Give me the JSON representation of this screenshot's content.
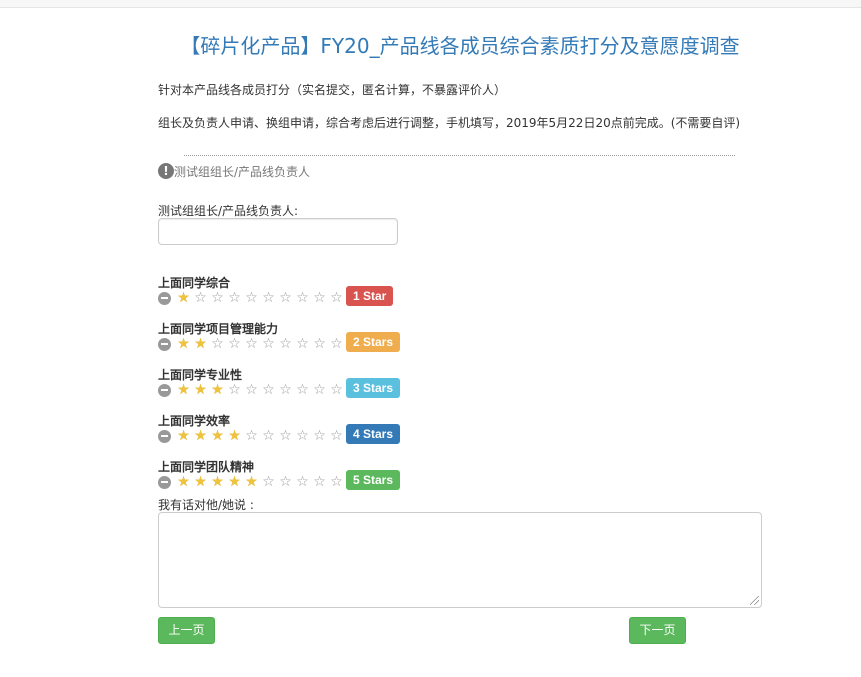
{
  "page": {
    "title": "【碎片化产品】FY20_产品线各成员综合素质打分及意愿度调查",
    "desc1": "针对本产品线各成员打分（实名提交，匿名计算，不暴露评价人）",
    "desc2": "组长及负责人申请、换组申请，综合考虑后进行调整，手机填写，2019年5月22日20点前完成。(不需要自评)"
  },
  "section": {
    "icon": "info-icon",
    "icon_glyph": "!",
    "label": "测试组组长/产品线负责人"
  },
  "field": {
    "label": "测试组组长/产品线负责人:",
    "value": "",
    "placeholder": ""
  },
  "ratings": [
    {
      "label": "上面同学综合",
      "stars": 1,
      "max": 10,
      "badge": "1 Star",
      "badge_color": "#d9534f"
    },
    {
      "label": "上面同学项目管理能力",
      "stars": 2,
      "max": 10,
      "badge": "2 Stars",
      "badge_color": "#f0ad4e"
    },
    {
      "label": "上面同学专业性",
      "stars": 3,
      "max": 10,
      "badge": "3 Stars",
      "badge_color": "#5bc0de"
    },
    {
      "label": "上面同学效率",
      "stars": 4,
      "max": 10,
      "badge": "4 Stars",
      "badge_color": "#337ab7"
    },
    {
      "label": "上面同学团队精神",
      "stars": 5,
      "max": 10,
      "badge": "5 Stars",
      "badge_color": "#5cb85c"
    }
  ],
  "comment": {
    "label": "我有话对他/她说 :",
    "value": ""
  },
  "nav": {
    "prev": "上一页",
    "next": "下一页"
  },
  "colors": {
    "title": "#337ab7",
    "button": "#5cb85c",
    "star_on": "#f0c33c",
    "star_off": "#999999"
  }
}
